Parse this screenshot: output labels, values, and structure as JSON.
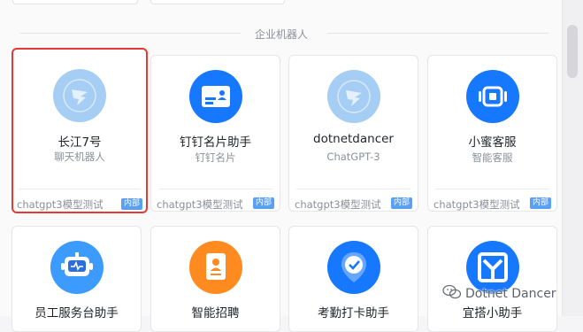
{
  "section": {
    "title": "企业机器人"
  },
  "cards": [
    {
      "name": "长江7号",
      "sub": "聊天机器人",
      "foot": "chatgpt3模型测试",
      "badge": "内部",
      "icon": "dingtalk-logo-icon",
      "icon_bg": "#a6cef5"
    },
    {
      "name": "钉钉名片助手",
      "sub": "钉钉名片",
      "foot": "chatgpt3模型测试",
      "badge": "内部",
      "icon": "business-card-icon",
      "icon_bg": "#1677ff"
    },
    {
      "name": "dotnetdancer",
      "sub": "ChatGPT-3",
      "foot": "chatgpt3模型测试",
      "badge": "内部",
      "icon": "dingtalk-logo-icon",
      "icon_bg": "#a6cef5"
    },
    {
      "name": "小蜜客服",
      "sub": "智能客服",
      "foot": "chatgpt3模型测试",
      "badge": "内部",
      "icon": "customer-service-icon",
      "icon_bg": "#1677ff"
    }
  ],
  "cards_row2": [
    {
      "name": "员工服务台助手",
      "icon": "robot-assistant-icon",
      "icon_bg": "#3d9bff"
    },
    {
      "name": "智能招聘",
      "icon": "resume-icon",
      "icon_bg": "#ff8a1f"
    },
    {
      "name": "考勤打卡助手",
      "icon": "checkin-icon",
      "icon_bg": "#1677ff"
    },
    {
      "name": "宜搭小助手",
      "icon": "yida-icon",
      "icon_bg": "#1677ff"
    }
  ],
  "watermark": {
    "text": "Dotnet Dancer",
    "icon": "wechat-icon"
  }
}
